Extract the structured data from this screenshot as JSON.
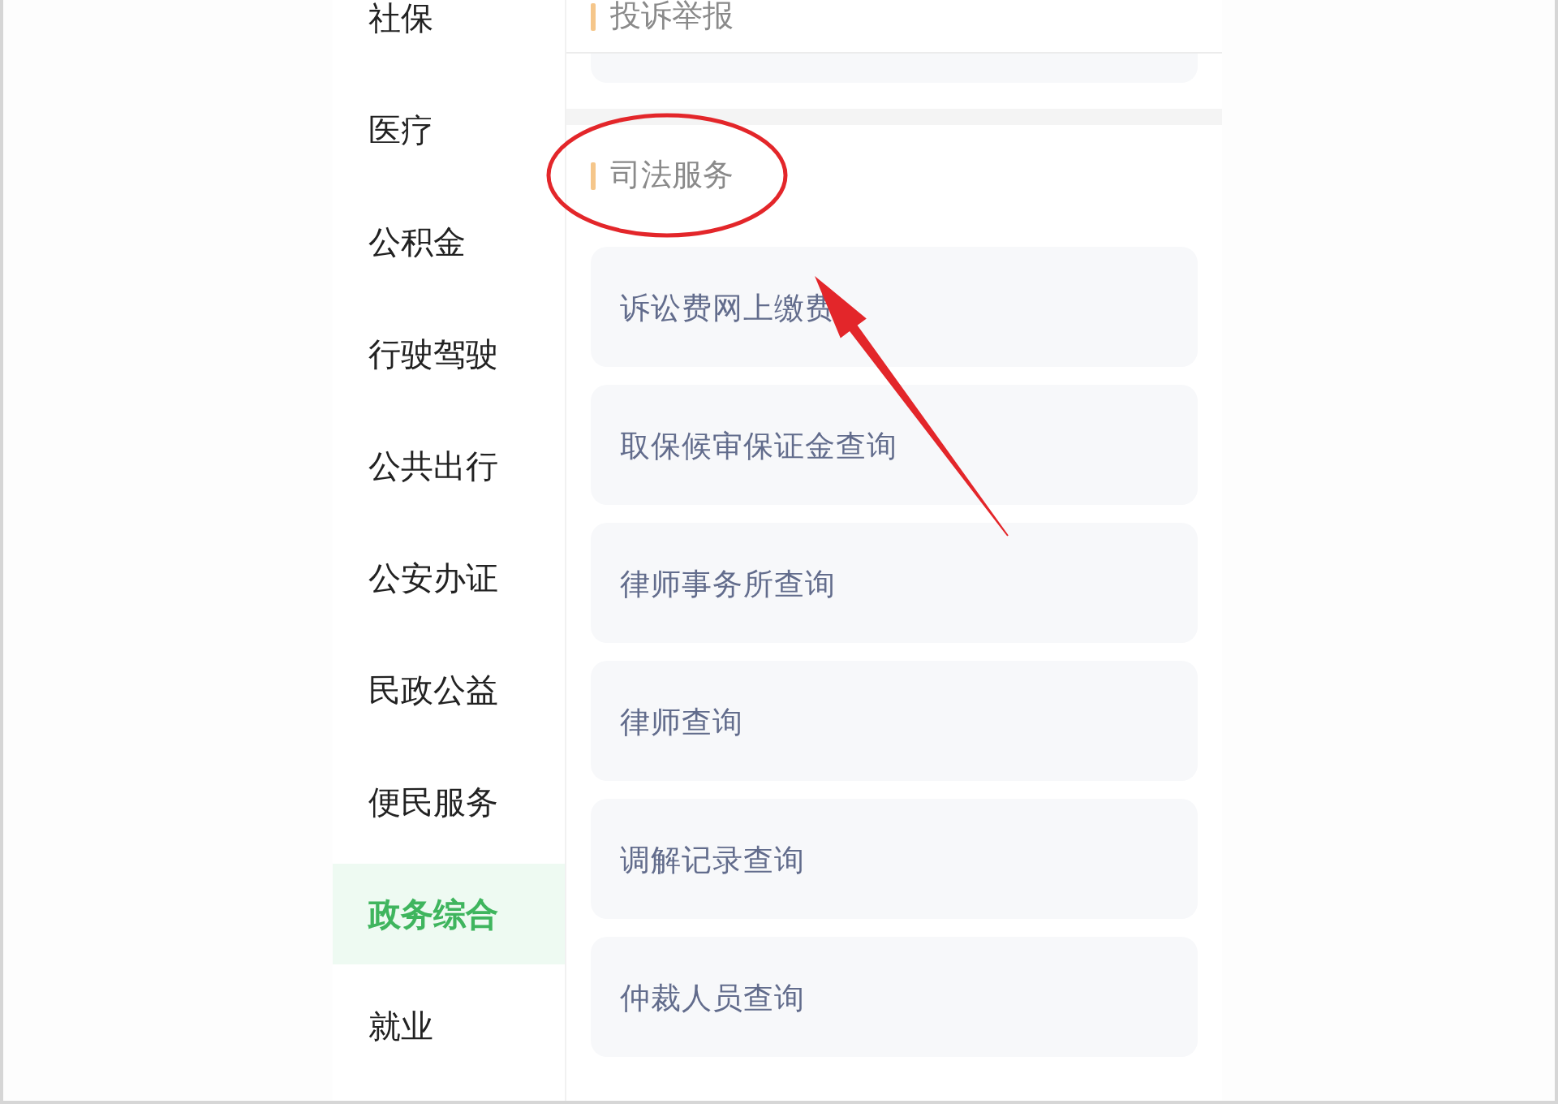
{
  "sidebar": {
    "items": [
      {
        "label": "社保",
        "selected": false
      },
      {
        "label": "医疗",
        "selected": false
      },
      {
        "label": "公积金",
        "selected": false
      },
      {
        "label": "行驶驾驶",
        "selected": false
      },
      {
        "label": "公共出行",
        "selected": false
      },
      {
        "label": "公安办证",
        "selected": false
      },
      {
        "label": "民政公益",
        "selected": false
      },
      {
        "label": "便民服务",
        "selected": false
      },
      {
        "label": "政务综合",
        "selected": true
      },
      {
        "label": "就业",
        "selected": false
      }
    ]
  },
  "top_section": {
    "title": "投诉举报"
  },
  "section": {
    "title": "司法服务",
    "items": [
      "诉讼费网上缴费",
      "取保候审保证金查询",
      "律师事务所查询",
      "律师查询",
      "调解记录查询",
      "仲裁人员查询"
    ]
  },
  "annotation": {
    "ellipse": true,
    "arrow": true
  }
}
